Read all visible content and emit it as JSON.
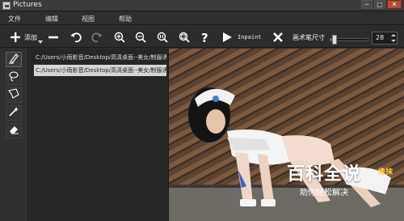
{
  "window": {
    "title": "Pictures",
    "buttons": {
      "minimize": "─",
      "maximize": "□",
      "close": "✕"
    }
  },
  "menu": [
    "文件",
    "编辑",
    "视图",
    "帮助"
  ],
  "toolbar": {
    "add_label": "添加",
    "inpaint_label": "Inpaint",
    "brush_size_label": "画术笔尺寸",
    "brush_size_value": "28",
    "brush_size_fraction": 0.12,
    "icons": [
      "plus-icon",
      "minus-icon",
      "undo-icon",
      "redo-icon",
      "zoom-in-icon",
      "zoom-out-icon",
      "zoom-actual-icon",
      "zoom-fit-icon",
      "help-icon",
      "play-icon",
      "close-icon"
    ]
  },
  "left_tools": [
    "pencil-marker-icon",
    "lasso-icon",
    "polygon-lasso-icon",
    "magic-wand-icon",
    "eraser-icon"
  ],
  "files": [
    {
      "path": "C:/Users/小雨影音/Desktop/高清桌面--美女/制服诱惑",
      "selected": false
    },
    {
      "path": "C:/Users/小雨影音/Desktop/高清桌面--美女/制服诱惑",
      "selected": true
    }
  ],
  "canvas": {
    "side_text": "缘抹"
  },
  "watermark": {
    "title": "百科全说",
    "subtitle": "助你轻松解决"
  },
  "colors": {
    "background": "#2b2b2b",
    "selection": "#d5d5d5",
    "close_button": "#b64b3b",
    "side_text": "#ffd84a"
  }
}
